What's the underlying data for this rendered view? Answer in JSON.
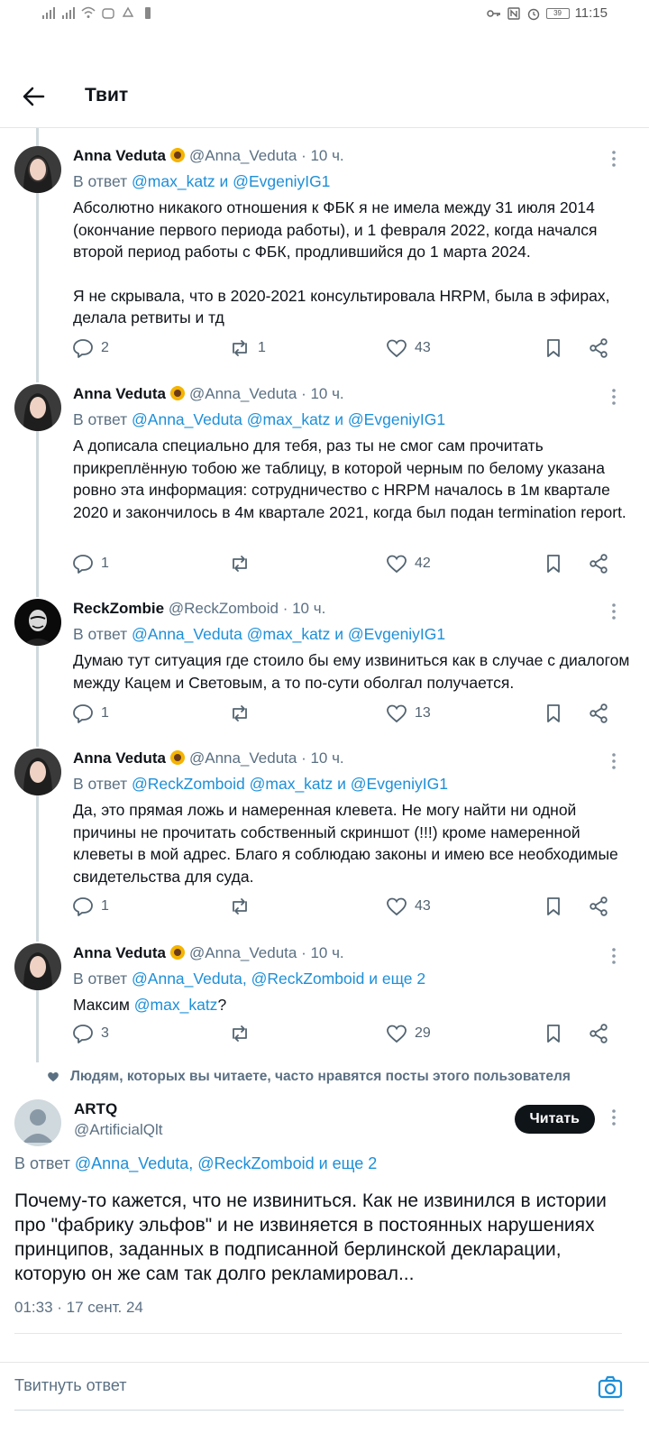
{
  "status_bar": {
    "time": "11:15",
    "battery": "39"
  },
  "header": {
    "title": "Твит"
  },
  "tweets": [
    {
      "name": "Anna Veduta",
      "handle": "@Anna_Veduta",
      "time": "· 10 ч.",
      "reply_prefix": "В ответ ",
      "reply_to": "@max_katz и @EvgeniyIG1",
      "text": "Абсолютно никакого отношения к ФБК я не имела между 31 июля 2014 (окончание первого периода работы), и 1 февраля 2022, когда начался второй период работы с ФБК, продлившийся до 1 марта 2024.",
      "text2": "Я не скрывала, что в 2020-2021 консультировала HRPM, была в эфирах, делала ретвиты и тд",
      "replies": "2",
      "retweets": "1",
      "likes": "43"
    },
    {
      "name": "Anna Veduta",
      "handle": "@Anna_Veduta",
      "time": "· 10 ч.",
      "reply_prefix": "В ответ ",
      "reply_to": "@Anna_Veduta @max_katz и @EvgeniyIG1",
      "text": "А дописала специально для тебя, раз ты не смог сам прочитать прикреплённую тобою же таблицу, в которой черным по белому указана ровно эта информация: сотрудничество с HRPM началось в 1м квартале 2020 и закончилось в 4м квартале 2021, когда был подан termination report.",
      "replies": "1",
      "retweets": "",
      "likes": "42"
    },
    {
      "name": "ReckZombie",
      "handle": "@ReckZomboid",
      "time": "· 10 ч.",
      "reply_prefix": "В ответ ",
      "reply_to": "@Anna_Veduta @max_katz и @EvgeniyIG1",
      "text": "Думаю тут ситуация где стоило бы ему извиниться как в случае с диалогом между Кацем и Световым, а то по-сути оболгал получается.",
      "replies": "1",
      "retweets": "",
      "likes": "13"
    },
    {
      "name": "Anna Veduta",
      "handle": "@Anna_Veduta",
      "time": "· 10 ч.",
      "reply_prefix": "В ответ ",
      "reply_to": "@ReckZomboid @max_katz и @EvgeniyIG1",
      "text": "Да, это прямая ложь и намеренная клевета. Не могу найти ни одной причины не прочитать собственный скриншот (!!!) кроме намеренной клеветы в мой адрес. Благо я соблюдаю законы и имею все необходимые свидетельства для суда.",
      "replies": "1",
      "retweets": "",
      "likes": "43"
    },
    {
      "name": "Anna Veduta",
      "handle": "@Anna_Veduta",
      "time": "· 10 ч.",
      "reply_prefix": "В ответ ",
      "reply_to": "@Anna_Veduta, @ReckZomboid и еще 2",
      "text_prefix": "Максим ",
      "text_mention": "@max_katz",
      "text_suffix": "?",
      "replies": "3",
      "retweets": "",
      "likes": "29"
    }
  ],
  "social_context": "Людям, которых вы читаете, часто нравятся посты этого пользователя",
  "main_tweet": {
    "name": "ARTQ",
    "handle": "@ArtificialQlt",
    "follow_label": "Читать",
    "reply_prefix": "В ответ ",
    "reply_to": "@Anna_Veduta, @ReckZomboid и еще 2",
    "text": "Почему-то кажется, что не извиниться. Как не извинился в истории про \"фабрику эльфов\" и не извиняется в постоянных нарушениях принципов, заданных в подписанной берлинской декларации, которую он же сам так долго рекламировал...",
    "timestamp": "01:33 · 17 сент. 24"
  },
  "reply_box": {
    "placeholder": "Твитнуть ответ"
  },
  "colors": {
    "accent": "#1d8fd8",
    "text": "#0f1419",
    "muted": "#5b7083",
    "thread_line": "#cfd9de"
  }
}
